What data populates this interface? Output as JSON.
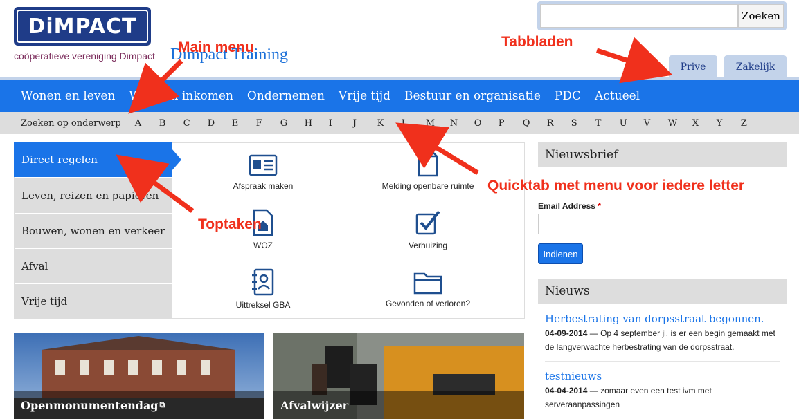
{
  "header": {
    "logo_text": "DiMPACT",
    "logo_subtitle": "coöperatieve vereniging Dimpact",
    "site_title": "Dimpact Training",
    "search_placeholder": "",
    "search_button": "Zoeken",
    "tabs": [
      {
        "label": "Prive"
      },
      {
        "label": "Zakelijk"
      }
    ]
  },
  "main_menu": {
    "items": [
      {
        "label": "Wonen en leven"
      },
      {
        "label": "Werk en inkomen"
      },
      {
        "label": "Ondernemen"
      },
      {
        "label": "Vrije tijd"
      },
      {
        "label": "Bestuur en organisatie"
      },
      {
        "label": "PDC"
      },
      {
        "label": "Actueel"
      }
    ]
  },
  "alphabet_bar": {
    "label": "Zoeken op onderwerp",
    "letters": [
      "A",
      "B",
      "C",
      "D",
      "E",
      "F",
      "G",
      "H",
      "I",
      "J",
      "K",
      "L",
      "M",
      "N",
      "O",
      "P",
      "Q",
      "R",
      "S",
      "T",
      "U",
      "V",
      "W",
      "X",
      "Y",
      "Z"
    ]
  },
  "toptaken": {
    "categories": [
      {
        "label": "Direct regelen",
        "active": true
      },
      {
        "label": "Leven, reizen en papieren"
      },
      {
        "label": "Bouwen, wonen en verkeer"
      },
      {
        "label": "Afval"
      },
      {
        "label": "Vrije tijd"
      }
    ],
    "tasks": [
      {
        "label": "Afspraak maken",
        "icon": "id-card-icon"
      },
      {
        "label": "Melding openbare ruimte",
        "icon": "document-icon"
      },
      {
        "label": "WOZ",
        "icon": "house-document-icon"
      },
      {
        "label": "Verhuizing",
        "icon": "checklist-icon"
      },
      {
        "label": "Uittreksel GBA",
        "icon": "address-book-icon"
      },
      {
        "label": "Gevonden of verloren?",
        "icon": "folder-icon"
      }
    ]
  },
  "newsletter": {
    "title": "Nieuwsbrief",
    "email_label": "Email Address",
    "required_mark": "*",
    "submit_label": "Indienen"
  },
  "news": {
    "title": "Nieuws",
    "items": [
      {
        "title": "Herbestrating van dorpsstraat begonnen.",
        "date": "04-09-2014",
        "separator": " — ",
        "summary": "Op 4 september jl. is er een begin gemaakt met de langverwachte herbestrating van de dorpsstraat."
      },
      {
        "title": "testnieuws",
        "date": "04-04-2014",
        "separator": " — ",
        "summary": "zomaar even een test ivm met serveraanpassingen"
      }
    ]
  },
  "promos": [
    {
      "label": "Openmonumentendag",
      "external_icon": "external-link-icon"
    },
    {
      "label": "Afvalwijzer"
    }
  ],
  "annotations": {
    "main_menu": "Main menu",
    "tabbladen": "Tabbladen",
    "quicktab": "Quicktab met menu voor iedere letter",
    "toptaken": "Toptaken"
  },
  "colors": {
    "brand_blue": "#1a74e8",
    "logo_navy": "#1f3c88",
    "annotation_red": "#f0301c"
  }
}
